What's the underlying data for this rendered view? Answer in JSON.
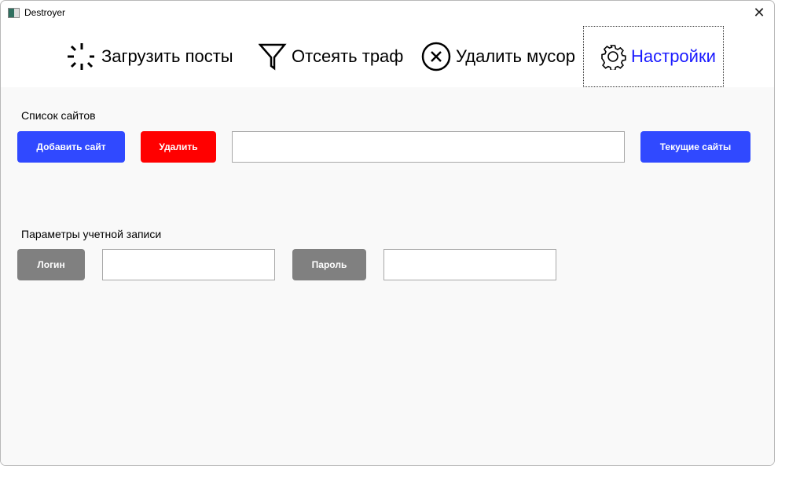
{
  "window": {
    "title": "Destroyer"
  },
  "nav": [
    {
      "label": "Загрузить посты",
      "icon": "loading-spinner-icon"
    },
    {
      "label": "Отсеять траф",
      "icon": "filter-icon"
    },
    {
      "label": "Удалить мусор",
      "icon": "close-circle-icon"
    },
    {
      "label": "Настройки",
      "icon": "gear-icon"
    }
  ],
  "sites": {
    "label": "Список сайтов",
    "add": "Добавить сайт",
    "delete": "Удалить",
    "input_value": "",
    "current": "Текущие сайты"
  },
  "account": {
    "label": "Параметры учетной записи",
    "login": "Логин",
    "login_value": "",
    "password": "Пароль",
    "password_value": ""
  },
  "colors": {
    "accent": "#3049ff",
    "danger": "#ff0000",
    "neutral": "#808080",
    "active_nav": "#1a1aff"
  }
}
